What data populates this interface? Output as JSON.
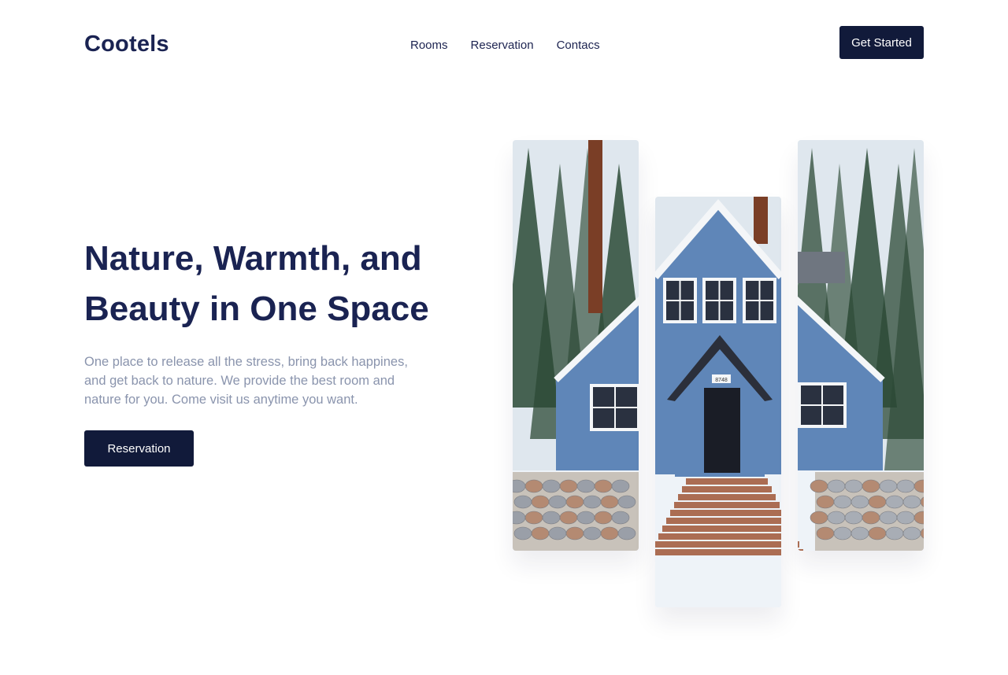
{
  "brand": {
    "logo": "Cootels"
  },
  "nav": {
    "items": [
      {
        "label": "Rooms"
      },
      {
        "label": "Reservation"
      },
      {
        "label": "Contacs"
      }
    ],
    "cta_label": "Get Started"
  },
  "hero": {
    "headline": "Nature, Warmth, and Beauty in One Space",
    "subtitle": "One place to release all the stress, bring back happines, and get back to nature. We provide the best room and nature for you. Come visit us anytime you want.",
    "button_label": "Reservation"
  },
  "gallery": {
    "house_number": "8748",
    "colors": {
      "siding": "#5f86b8",
      "trim": "#f4f6f8",
      "roof": "#2b2f3a",
      "door": "#1a1d26",
      "trees": "#2c4a36",
      "trunk": "#7a3e26",
      "snow": "#eef3f8",
      "walkway": "#a6654a",
      "stone": "#b48a72"
    }
  }
}
